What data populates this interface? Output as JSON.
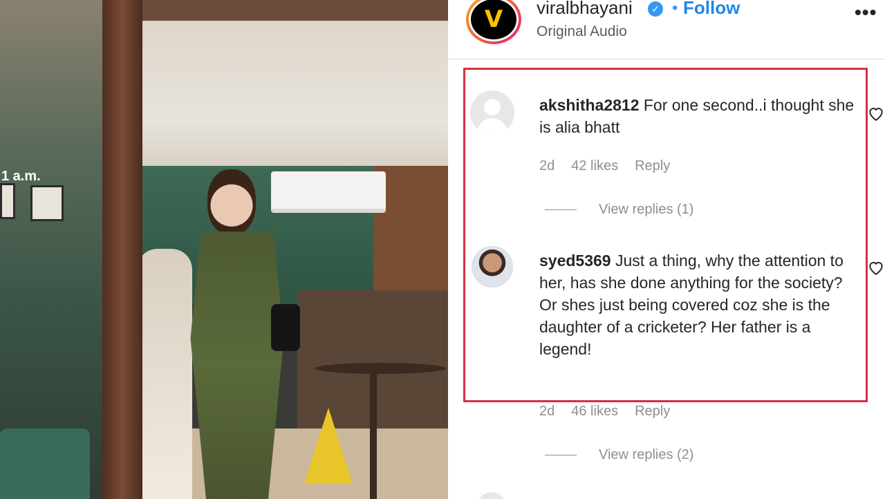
{
  "post": {
    "username": "viralbhayani",
    "separator": "•",
    "follow_label": "Follow",
    "audio_label": "Original Audio",
    "more_icon": "more-horizontal-icon",
    "avatar_logo": "V"
  },
  "media": {
    "wall_sign": "1 a.m."
  },
  "comments": [
    {
      "username": "akshitha2812",
      "text": "For one second..i thought she is alia bhatt",
      "time": "2d",
      "likes": "42 likes",
      "reply_label": "Reply",
      "view_replies": "View replies (1)",
      "avatar": "default-avatar-icon"
    },
    {
      "username": "syed5369",
      "text": "Just a thing, why the attention to her, has she done anything for the society? Or shes just being covered coz she is the daughter of a cricketer? Her father is a legend!",
      "time": "2d",
      "likes": "46 likes",
      "reply_label": "Reply",
      "view_replies": "View replies (2)",
      "avatar": "user-photo-avatar"
    }
  ],
  "colors": {
    "follow": "#1e88e5",
    "verified": "#3897f0",
    "highlight_border": "#d32f3f",
    "meta_text": "#8e8e8e"
  }
}
